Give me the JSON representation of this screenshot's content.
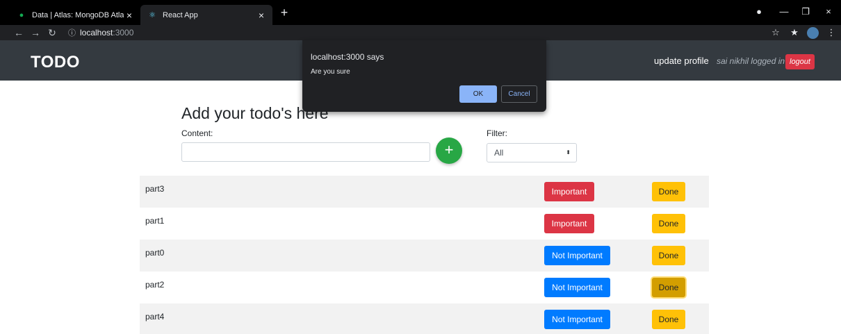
{
  "browser": {
    "tabs": [
      {
        "title": "Data | Atlas: MongoDB Atlas",
        "icon": "leaf-icon",
        "active": false
      },
      {
        "title": "React App",
        "icon": "react-atom-icon",
        "active": true
      }
    ],
    "address": {
      "host": "localhost",
      "port": ":3000"
    },
    "colors": {
      "chrome": "#000000",
      "toolbar": "#202124"
    }
  },
  "navbar": {
    "brand": "TODO",
    "update_profile": "update profile",
    "logged_in_text": "sai nikhil logged in",
    "logout_label": "logout",
    "colors": {
      "background": "#343a40",
      "logout": "#dc3545"
    }
  },
  "form": {
    "title": "Add your todo's here",
    "content_label": "Content:",
    "content_value": "",
    "add_button_label": "+",
    "filter_label": "Filter:",
    "filter_selected": "All",
    "colors": {
      "add_button": "#28a745"
    }
  },
  "todos": [
    {
      "text": "part3",
      "importance_label": "Important",
      "importance_color": "#dc3545",
      "done_label": "Done"
    },
    {
      "text": "part1",
      "importance_label": "Important",
      "importance_color": "#dc3545",
      "done_label": "Done"
    },
    {
      "text": "part0",
      "importance_label": "Not Important",
      "importance_color": "#007bff",
      "done_label": "Done"
    },
    {
      "text": "part2",
      "importance_label": "Not Important",
      "importance_color": "#007bff",
      "done_label": "Done"
    },
    {
      "text": "part4",
      "importance_label": "Not Important",
      "importance_color": "#007bff",
      "done_label": "Done"
    }
  ],
  "dialog": {
    "title": "localhost:3000 says",
    "message": "Are you sure",
    "ok_label": "OK",
    "cancel_label": "Cancel",
    "colors": {
      "ok": "#8ab4f8",
      "background": "#202124"
    }
  }
}
